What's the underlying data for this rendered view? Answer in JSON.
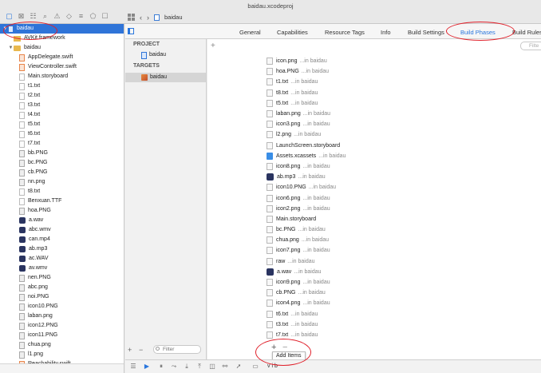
{
  "window": {
    "title": "baidau.xcodeproj"
  },
  "jumpbar": {
    "crumb": "baidau"
  },
  "navigator": {
    "rows": [
      {
        "label": "baidau",
        "icon": "proj",
        "indent": 0,
        "disclosure": "▼",
        "selected": true
      },
      {
        "label": "AVKit.framework",
        "icon": "framework",
        "indent": 1,
        "disclosure": "",
        "selected": false
      },
      {
        "label": "baidau",
        "icon": "folder",
        "indent": 1,
        "disclosure": "▼",
        "selected": false
      },
      {
        "label": "AppDelegate.swift",
        "icon": "swift",
        "indent": 2,
        "disclosure": "",
        "selected": false
      },
      {
        "label": "ViewController.swift",
        "icon": "swift",
        "indent": 2,
        "disclosure": "",
        "selected": false
      },
      {
        "label": "Main.storyboard",
        "icon": "file",
        "indent": 2,
        "disclosure": "",
        "selected": false
      },
      {
        "label": "t1.txt",
        "icon": "file",
        "indent": 2,
        "disclosure": "",
        "selected": false
      },
      {
        "label": "t2.txt",
        "icon": "file",
        "indent": 2,
        "disclosure": "",
        "selected": false
      },
      {
        "label": "t3.txt",
        "icon": "file",
        "indent": 2,
        "disclosure": "",
        "selected": false
      },
      {
        "label": "t4.txt",
        "icon": "file",
        "indent": 2,
        "disclosure": "",
        "selected": false
      },
      {
        "label": "t5.txt",
        "icon": "file",
        "indent": 2,
        "disclosure": "",
        "selected": false
      },
      {
        "label": "t6.txt",
        "icon": "file",
        "indent": 2,
        "disclosure": "",
        "selected": false
      },
      {
        "label": "t7.txt",
        "icon": "file",
        "indent": 2,
        "disclosure": "",
        "selected": false
      },
      {
        "label": "bb.PNG",
        "icon": "image",
        "indent": 2,
        "disclosure": "",
        "selected": false
      },
      {
        "label": "bc.PNG",
        "icon": "image",
        "indent": 2,
        "disclosure": "",
        "selected": false
      },
      {
        "label": "cb.PNG",
        "icon": "image",
        "indent": 2,
        "disclosure": "",
        "selected": false
      },
      {
        "label": "nn.png",
        "icon": "image",
        "indent": 2,
        "disclosure": "",
        "selected": false
      },
      {
        "label": "t8.txt",
        "icon": "file",
        "indent": 2,
        "disclosure": "",
        "selected": false
      },
      {
        "label": "Benxuan.TTF",
        "icon": "file",
        "indent": 2,
        "disclosure": "",
        "selected": false
      },
      {
        "label": "hoa.PNG",
        "icon": "image",
        "indent": 2,
        "disclosure": "",
        "selected": false
      },
      {
        "label": "a.wav",
        "icon": "audio",
        "indent": 2,
        "disclosure": "",
        "selected": false
      },
      {
        "label": "abc.wmv",
        "icon": "audio",
        "indent": 2,
        "disclosure": "",
        "selected": false
      },
      {
        "label": "can.mp4",
        "icon": "audio",
        "indent": 2,
        "disclosure": "",
        "selected": false
      },
      {
        "label": "ab.mp3",
        "icon": "audio",
        "indent": 2,
        "disclosure": "",
        "selected": false
      },
      {
        "label": "ac.WAV",
        "icon": "audio",
        "indent": 2,
        "disclosure": "",
        "selected": false
      },
      {
        "label": "av.wmv",
        "icon": "audio",
        "indent": 2,
        "disclosure": "",
        "selected": false
      },
      {
        "label": "nen.PNG",
        "icon": "image",
        "indent": 2,
        "disclosure": "",
        "selected": false
      },
      {
        "label": "abc.png",
        "icon": "image",
        "indent": 2,
        "disclosure": "",
        "selected": false
      },
      {
        "label": "noi.PNG",
        "icon": "image",
        "indent": 2,
        "disclosure": "",
        "selected": false
      },
      {
        "label": "icon10.PNG",
        "icon": "image",
        "indent": 2,
        "disclosure": "",
        "selected": false
      },
      {
        "label": "laban.png",
        "icon": "image",
        "indent": 2,
        "disclosure": "",
        "selected": false
      },
      {
        "label": "icon12.PNG",
        "icon": "image",
        "indent": 2,
        "disclosure": "",
        "selected": false
      },
      {
        "label": "icon11.PNG",
        "icon": "image",
        "indent": 2,
        "disclosure": "",
        "selected": false
      },
      {
        "label": "chua.png",
        "icon": "image",
        "indent": 2,
        "disclosure": "",
        "selected": false
      },
      {
        "label": "l1.png",
        "icon": "image",
        "indent": 2,
        "disclosure": "",
        "selected": false
      },
      {
        "label": "Reachability.swift",
        "icon": "swift",
        "indent": 2,
        "disclosure": "",
        "selected": false
      }
    ]
  },
  "tabs": [
    {
      "label": "General",
      "active": false
    },
    {
      "label": "Capabilities",
      "active": false
    },
    {
      "label": "Resource Tags",
      "active": false
    },
    {
      "label": "Info",
      "active": false
    },
    {
      "label": "Build Settings",
      "active": false
    },
    {
      "label": "Build Phases",
      "active": true
    },
    {
      "label": "Build Rules",
      "active": false
    }
  ],
  "targets_panel": {
    "project_header": "PROJECT",
    "project_item": "baidau",
    "targets_header": "TARGETS",
    "target_item": "baidau",
    "filter_placeholder": "Filter"
  },
  "phases": {
    "filter_placeholder": "Filte",
    "add_tooltip": "Add Items",
    "files": [
      {
        "name": "icon.png",
        "loc": "...in baidau",
        "icon": "image"
      },
      {
        "name": "hoa.PNG",
        "loc": "...in baidau",
        "icon": "image"
      },
      {
        "name": "t1.txt",
        "loc": "...in baidau",
        "icon": "file"
      },
      {
        "name": "t8.txt",
        "loc": "...in baidau",
        "icon": "file"
      },
      {
        "name": "t5.txt",
        "loc": "...in baidau",
        "icon": "file"
      },
      {
        "name": "laban.png",
        "loc": "...in baidau",
        "icon": "image"
      },
      {
        "name": "icon3.png",
        "loc": "...in baidau",
        "icon": "image"
      },
      {
        "name": "l2.png",
        "loc": "...in baidau",
        "icon": "image"
      },
      {
        "name": "LaunchScreen.storyboard",
        "loc": "",
        "icon": "file"
      },
      {
        "name": "Assets.xcassets",
        "loc": "...in baidau",
        "icon": "assets"
      },
      {
        "name": "icon8.png",
        "loc": "...in baidau",
        "icon": "image"
      },
      {
        "name": "ab.mp3",
        "loc": "...in baidau",
        "icon": "audio"
      },
      {
        "name": "icon10.PNG",
        "loc": "...in baidau",
        "icon": "image"
      },
      {
        "name": "icon6.png",
        "loc": "...in baidau",
        "icon": "image"
      },
      {
        "name": "icon2.png",
        "loc": "...in baidau",
        "icon": "image"
      },
      {
        "name": "Main.storyboard",
        "loc": "",
        "icon": "file"
      },
      {
        "name": "bc.PNG",
        "loc": "...in baidau",
        "icon": "image"
      },
      {
        "name": "chua.png",
        "loc": "...in baidau",
        "icon": "image"
      },
      {
        "name": "icon7.png",
        "loc": "...in baidau",
        "icon": "image"
      },
      {
        "name": "raw",
        "loc": "...in baidau",
        "icon": "file"
      },
      {
        "name": "a.wav",
        "loc": "...in baidau",
        "icon": "audio"
      },
      {
        "name": "icon9.png",
        "loc": "...in baidau",
        "icon": "image"
      },
      {
        "name": "cb.PNG",
        "loc": "...in baidau",
        "icon": "image"
      },
      {
        "name": "icon4.png",
        "loc": "...in baidau",
        "icon": "image"
      },
      {
        "name": "t6.txt",
        "loc": "...in baidau",
        "icon": "file"
      },
      {
        "name": "t3.txt",
        "loc": "...in baidau",
        "icon": "file"
      },
      {
        "name": "t7.txt",
        "loc": "...in baidau",
        "icon": "file"
      }
    ]
  },
  "debugbar": {
    "label": "v i b"
  },
  "colors": {
    "accent": "#2a76dd",
    "selection": "#2f74d8",
    "annotation": "#e0202a"
  }
}
